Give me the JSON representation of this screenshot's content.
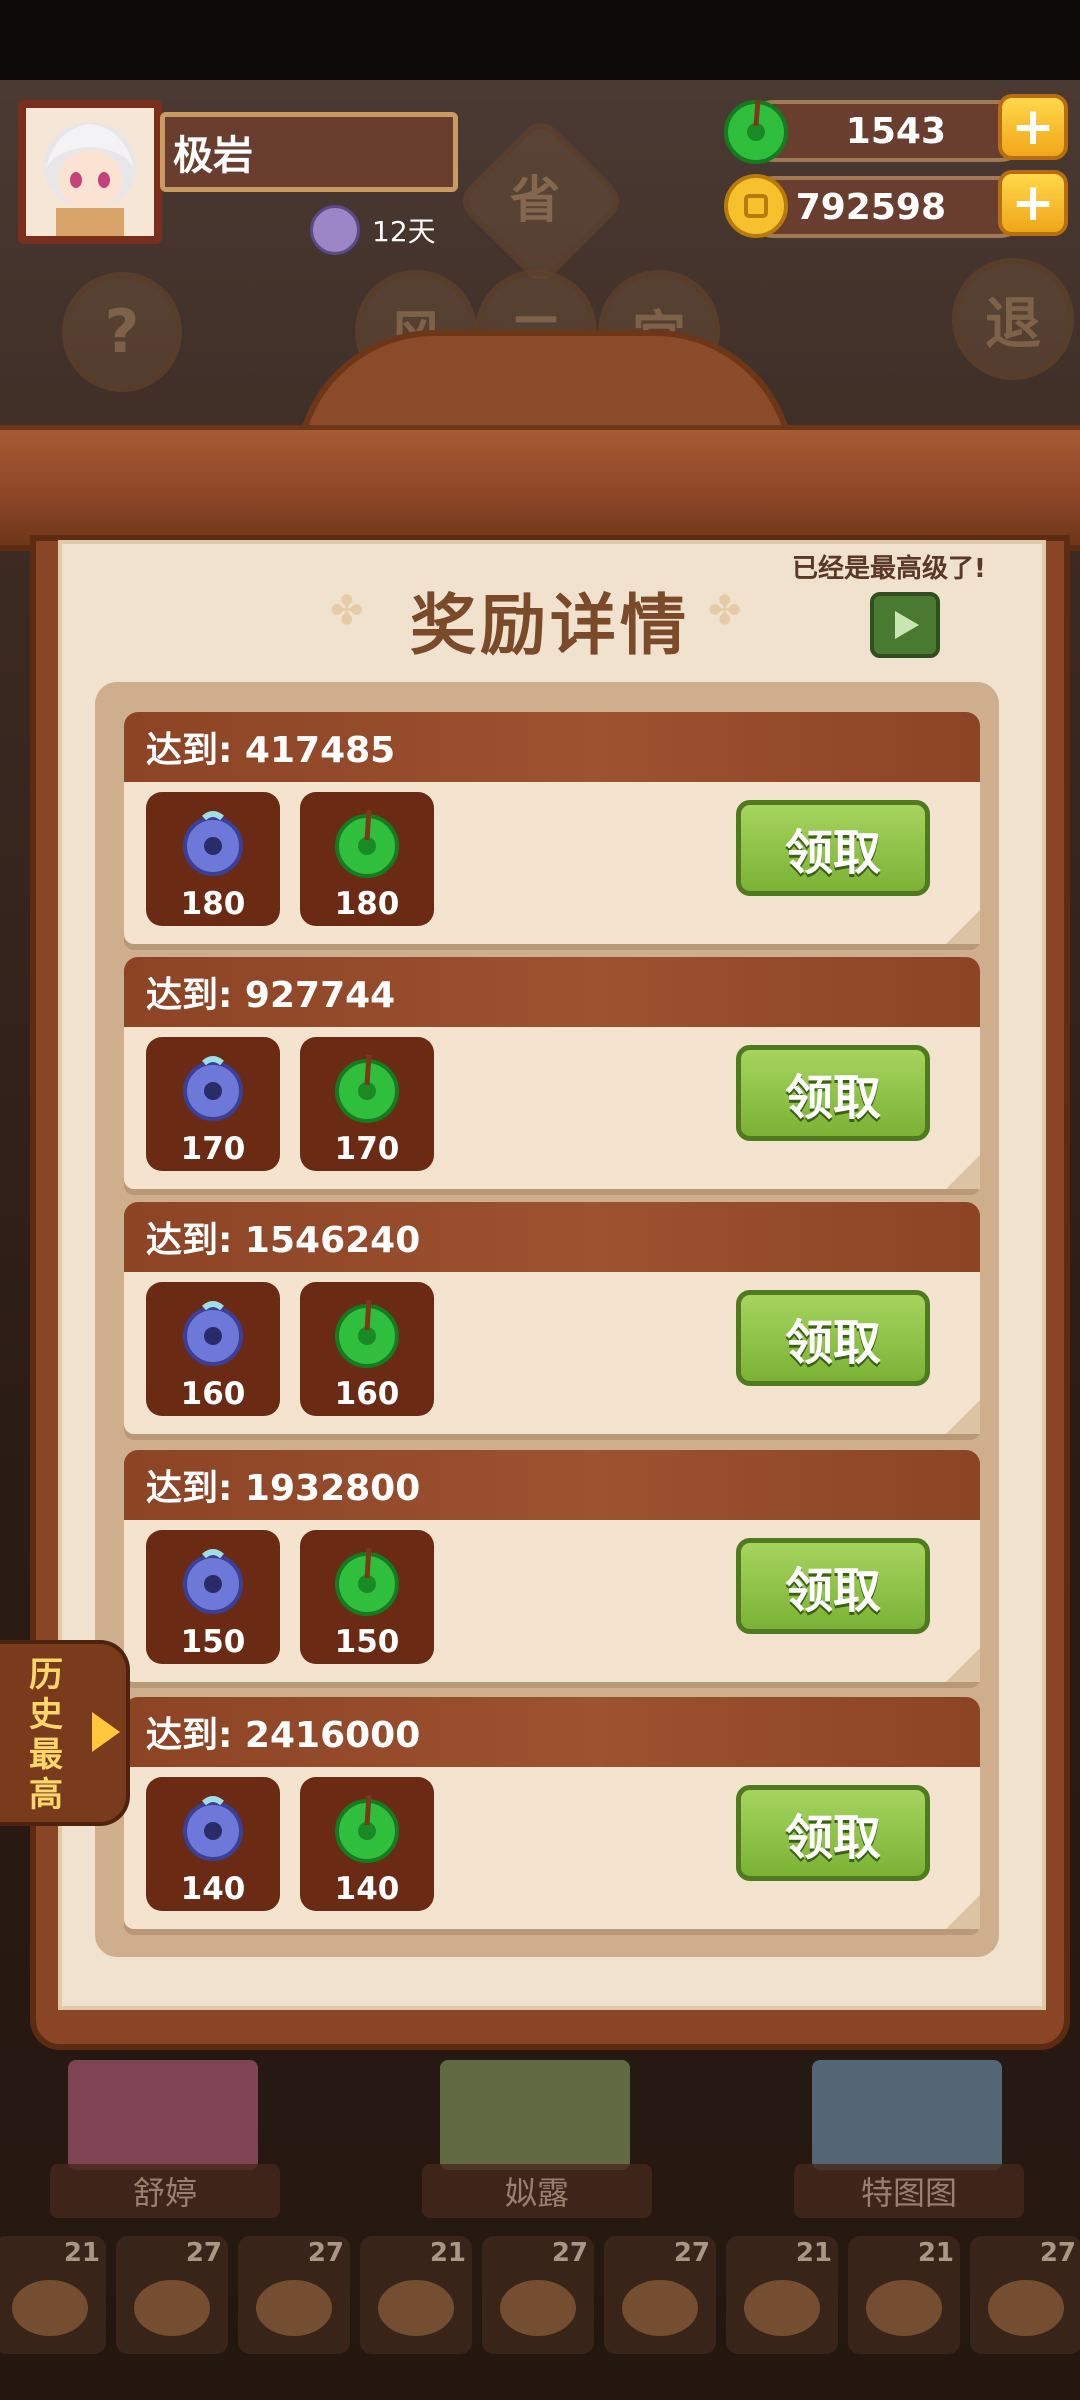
{
  "header": {
    "player_name": "极岩",
    "days_label": "12天",
    "jade_amount": "1543",
    "coin_amount": "792598"
  },
  "background": {
    "badge_char": "省",
    "help_char": "?",
    "exit_char": "退",
    "seat_chars": [
      "风",
      "二",
      "宫"
    ],
    "characters": [
      "舒婷",
      "姒露",
      "特图图"
    ],
    "food_levels": [
      "21",
      "27",
      "27",
      "21",
      "27",
      "27",
      "21",
      "21",
      "27"
    ]
  },
  "panel": {
    "max_level_msg": "已经是最高级了!",
    "title": "奖励详情",
    "claim_label": "领取",
    "history_label": "历史最高",
    "rows": [
      {
        "reach": "达到: 417485",
        "blue_qty": "180",
        "green_qty": "180"
      },
      {
        "reach": "达到: 927744",
        "blue_qty": "170",
        "green_qty": "170"
      },
      {
        "reach": "达到: 1546240",
        "blue_qty": "160",
        "green_qty": "160"
      },
      {
        "reach": "达到: 1932800",
        "blue_qty": "150",
        "green_qty": "150"
      },
      {
        "reach": "达到: 2416000",
        "blue_qty": "140",
        "green_qty": "140"
      }
    ]
  },
  "colors": {
    "claim_green": "#7bb235",
    "row_header": "#8c4425",
    "paper": "#f0e2cf",
    "frame": "#8a4526"
  }
}
